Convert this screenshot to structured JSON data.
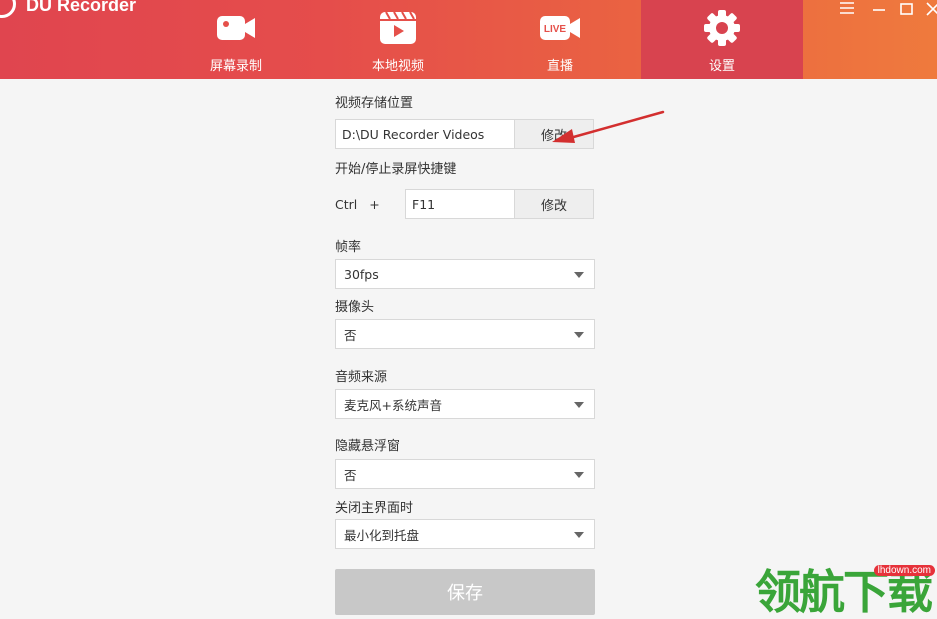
{
  "app": {
    "title": "DU Recorder"
  },
  "nav": {
    "tabs": [
      {
        "label": "屏幕录制",
        "icon": "video-camera-icon"
      },
      {
        "label": "本地视频",
        "icon": "clapperboard-icon"
      },
      {
        "label": "直播",
        "icon": "live-icon",
        "badge": "LIVE"
      },
      {
        "label": "设置",
        "icon": "gear-icon",
        "active": true
      }
    ]
  },
  "window_controls": [
    "menu-icon",
    "minimize-icon",
    "maximize-icon",
    "close-icon"
  ],
  "settings": {
    "storage": {
      "label": "视频存储位置",
      "value": "D:\\DU Recorder Videos",
      "button": "修改"
    },
    "hotkey": {
      "label": "开始/停止录屏快捷键",
      "modifier": "Ctrl",
      "plus": "+",
      "key": "F11",
      "button": "修改"
    },
    "fps": {
      "label": "帧率",
      "value": "30fps"
    },
    "camera": {
      "label": "摄像头",
      "value": "否"
    },
    "audio": {
      "label": "音频来源",
      "value": "麦克风+系统声音"
    },
    "hide_float": {
      "label": "隐藏悬浮窗",
      "value": "否"
    },
    "close_main": {
      "label": "关闭主界面时",
      "value": "最小化到托盘"
    },
    "save_label": "保存"
  },
  "watermark": {
    "text": "领航下载",
    "url": "lhdown.com"
  },
  "colors": {
    "header_start": "#e0454f",
    "header_end": "#ef7a3d",
    "active_tab": "#d8434f",
    "arrow": "#d32f2f"
  }
}
